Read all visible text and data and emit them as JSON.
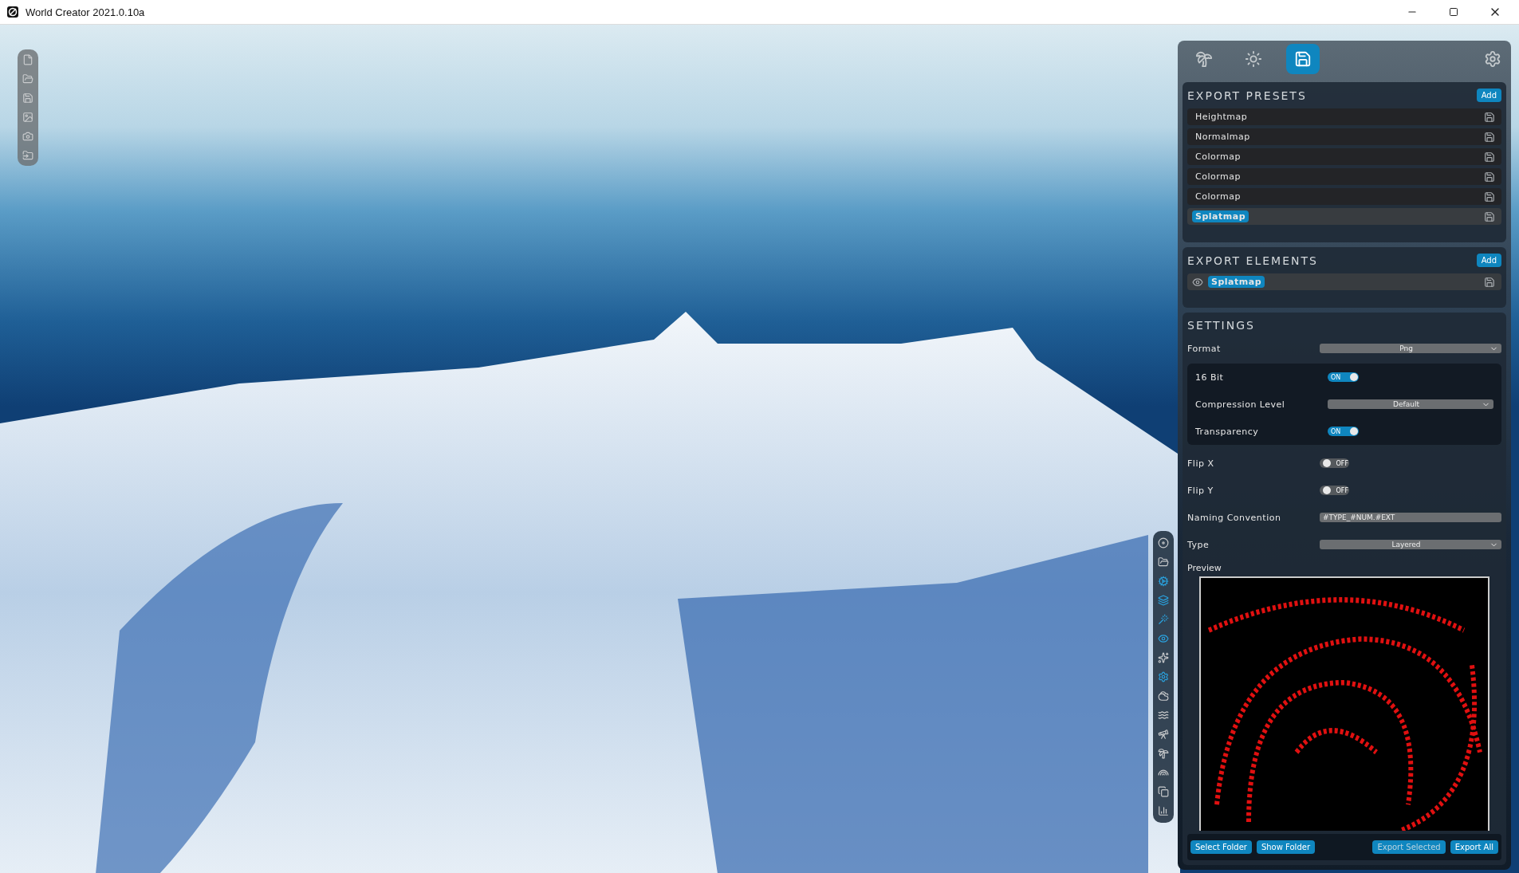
{
  "window": {
    "title": "World Creator 2021.0.10a"
  },
  "panel_tabs": [
    {
      "kind": "terrain",
      "selected": false
    },
    {
      "kind": "sun",
      "selected": false
    },
    {
      "kind": "export",
      "selected": true
    }
  ],
  "export_presets": {
    "title": "EXPORT PRESETS",
    "add": "Add",
    "items": [
      {
        "label": "Heightmap",
        "selected": false
      },
      {
        "label": "Normalmap",
        "selected": false
      },
      {
        "label": "Colormap",
        "selected": false
      },
      {
        "label": "Colormap",
        "selected": false
      },
      {
        "label": "Colormap",
        "selected": false
      },
      {
        "label": "Splatmap",
        "selected": true
      }
    ]
  },
  "export_elements": {
    "title": "EXPORT ELEMENTS",
    "add": "Add",
    "items": [
      {
        "label": "Splatmap",
        "selected": true
      }
    ]
  },
  "settings": {
    "title": "SETTINGS",
    "rows": [
      {
        "kind": "select",
        "label": "Format",
        "value": "Png"
      },
      {
        "kind": "group",
        "rows": [
          {
            "kind": "toggle",
            "label": "16 Bit",
            "on": true,
            "text": "ON"
          },
          {
            "kind": "select",
            "label": "Compression Level",
            "value": "Default"
          },
          {
            "kind": "toggle",
            "label": "Transparency",
            "on": true,
            "text": "ON"
          }
        ]
      },
      {
        "kind": "toggle",
        "label": "Flip X",
        "on": false,
        "text": "OFF"
      },
      {
        "kind": "toggle",
        "label": "Flip Y",
        "on": false,
        "text": "OFF"
      },
      {
        "kind": "text",
        "label": "Naming Convention",
        "value": "#TYPE_#NUM.#EXT"
      },
      {
        "kind": "select",
        "label": "Type",
        "value": "Layered"
      }
    ],
    "preview_label": "Preview"
  },
  "buttons_left": [
    "Select Folder",
    "Show Folder"
  ],
  "buttons_right": [
    {
      "label": "Export Selected",
      "disabled": true
    },
    {
      "label": "Export All",
      "disabled": false
    }
  ]
}
